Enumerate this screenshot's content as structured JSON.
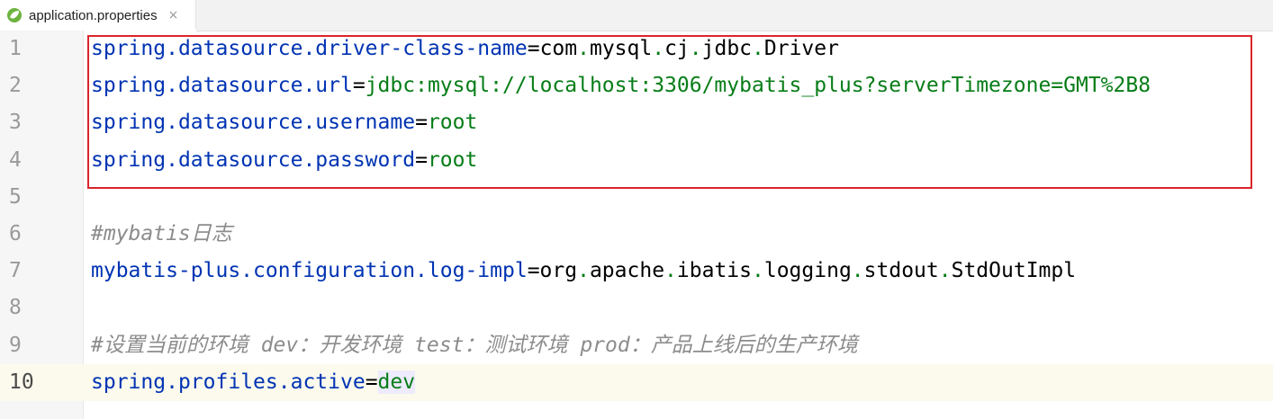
{
  "tab": {
    "label": "application.properties",
    "close": "×",
    "icon": "spring-leaf-icon"
  },
  "colors": {
    "key": "#0033b3",
    "value": "#067d17",
    "comment": "#8c8c8c",
    "highlight": "#d9252b",
    "current_line": "#fcfaed"
  },
  "lines": [
    {
      "no": "1",
      "key": "spring.datasource.driver-class-name",
      "value": "com.mysql.cj.jdbc.Driver"
    },
    {
      "no": "2",
      "key": "spring.datasource.url",
      "value": "jdbc:mysql://localhost:3306/mybatis_plus?serverTimezone=GMT%2B8"
    },
    {
      "no": "3",
      "key": "spring.datasource.username",
      "value": "root"
    },
    {
      "no": "4",
      "key": "spring.datasource.password",
      "value": "root"
    },
    {
      "no": "5"
    },
    {
      "no": "6",
      "comment": "#mybatis日志"
    },
    {
      "no": "7",
      "key": "mybatis-plus.configuration.log-impl",
      "value": "org.apache.ibatis.logging.stdout.StdOutImpl"
    },
    {
      "no": "8"
    },
    {
      "no": "9",
      "comment": "#设置当前的环境 dev：开发环境 test：测试环境 prod：产品上线后的生产环境"
    },
    {
      "no": "10",
      "key": "spring.profiles.active",
      "value": "dev"
    }
  ],
  "current_line": "10"
}
